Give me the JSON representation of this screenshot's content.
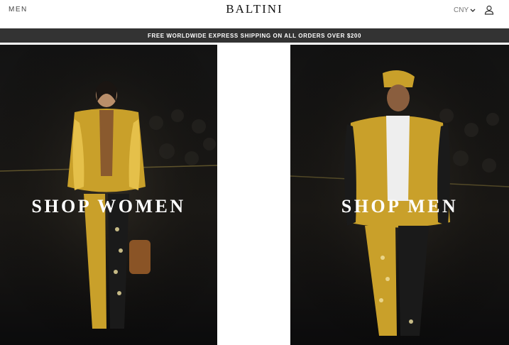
{
  "header": {
    "nav_men_label": "MEN",
    "logo_text": "BALTINI",
    "currency_label": "CNY",
    "user_icon": "user-icon",
    "currency_chevron_icon": "chevron-down-icon"
  },
  "banner": {
    "text": "FREE WORLDWIDE EXPRESS SHIPPING ON ALL ORDERS OVER $200"
  },
  "panels": [
    {
      "label": "SHOP WOMEN"
    },
    {
      "label": "SHOP MEN"
    }
  ],
  "colors": {
    "banner_bg": "#333333",
    "gold": "#c9a02a",
    "panel_dark": "#0d0d0f"
  }
}
